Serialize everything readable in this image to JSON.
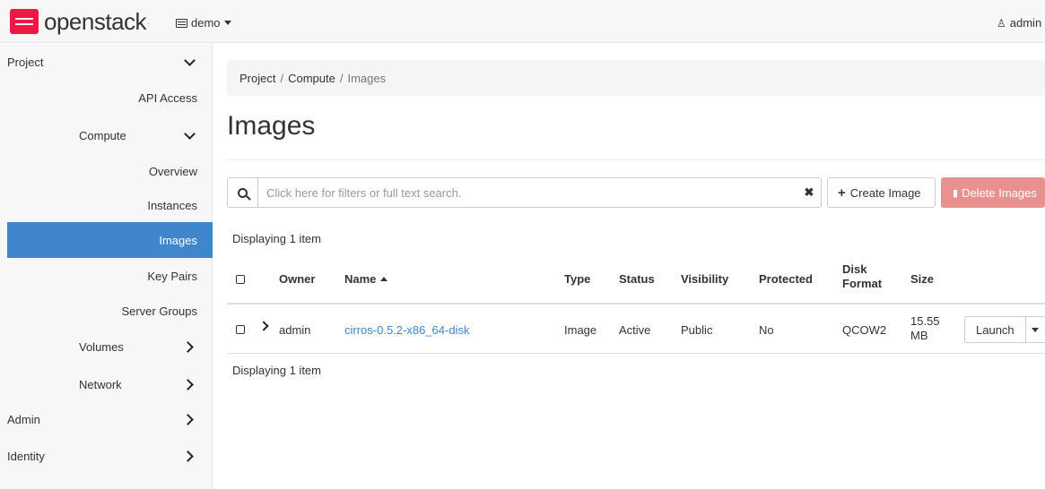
{
  "navbar": {
    "brand": "openstack",
    "project": "demo",
    "user": "admin"
  },
  "sidebar": {
    "project": "Project",
    "api_access": "API Access",
    "compute": "Compute",
    "overview": "Overview",
    "instances": "Instances",
    "images": "Images",
    "key_pairs": "Key Pairs",
    "server_groups": "Server Groups",
    "volumes": "Volumes",
    "network": "Network",
    "admin": "Admin",
    "identity": "Identity"
  },
  "breadcrumb": {
    "items": [
      "Project",
      "Compute",
      "Images"
    ],
    "separator": "/"
  },
  "page_title": "Images",
  "search": {
    "placeholder": "Click here for filters or full text search."
  },
  "actions": {
    "create": "Create Image",
    "delete": "Delete Images"
  },
  "count_top": "Displaying 1 item",
  "count_bottom": "Displaying 1 item",
  "table": {
    "headers": {
      "owner": "Owner",
      "name": "Name",
      "type": "Type",
      "status": "Status",
      "visibility": "Visibility",
      "protected": "Protected",
      "disk_format_1": "Disk",
      "disk_format_2": "Format",
      "size": "Size"
    },
    "rows": [
      {
        "owner": "admin",
        "name": "cirros-0.5.2-x86_64-disk",
        "type": "Image",
        "status": "Active",
        "visibility": "Public",
        "protected": "No",
        "disk_format": "QCOW2",
        "size_1": "15.55",
        "size_2": "MB",
        "action": "Launch"
      }
    ]
  },
  "colors": {
    "accent": "#3f86cc",
    "danger_disabled": "#e8918f",
    "brand": "#ed1944"
  }
}
